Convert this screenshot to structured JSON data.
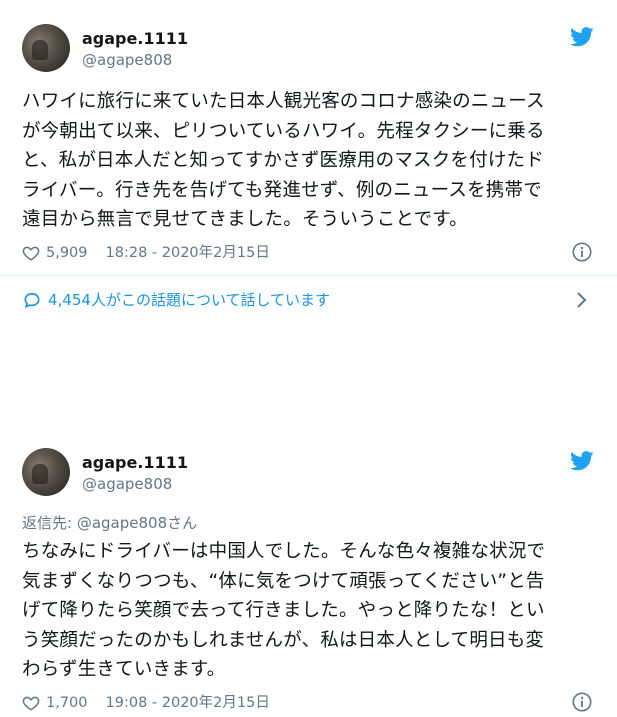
{
  "tweets": [
    {
      "name": "agape.1111",
      "handle": "@agape808",
      "reply_to": "",
      "text": "ハワイに旅行に来ていた日本人観光客のコロナ感染のニュース\nが今朝出て以来、ピリついているハワイ。先程タクシーに乗る\nと、私が日本人だと知ってすかさず医療用のマスクを付けたド\nライバー。行き先を告げても発進せず、例のニュースを携帯で\n遠目から無言で見せてきました。そういうことです。",
      "likes": "5,909",
      "timestamp": "18:28 - 2020年2月15日",
      "conversation": "4,454人がこの話題について話しています"
    },
    {
      "name": "agape.1111",
      "handle": "@agape808",
      "reply_to_prefix": "返信先:",
      "reply_to_handle": "@agape808",
      "reply_to_suffix": "さん",
      "text": "ちなみにドライバーは中国人でした。そんな色々複雑な状況で\n気まずくなりつつも、“体に気をつけて頑張ってください”と告\nげて降りたら笑顔で去って行きました。やっと降りたな！とい\nう笑顔だったのかもしれませんが、私は日本人として明日も変\nわらず生きていきます。",
      "likes": "1,700",
      "timestamp": "19:08 - 2020年2月15日"
    }
  ],
  "icons": {
    "brand": "twitter-bird-icon",
    "like": "heart-icon",
    "info": "info-icon",
    "reply": "speech-bubble-icon",
    "next": "chevron-right-icon"
  },
  "colors": {
    "accent": "#1da1f2",
    "link": "#1b95e0",
    "muted": "#657786",
    "text": "#14171a"
  }
}
